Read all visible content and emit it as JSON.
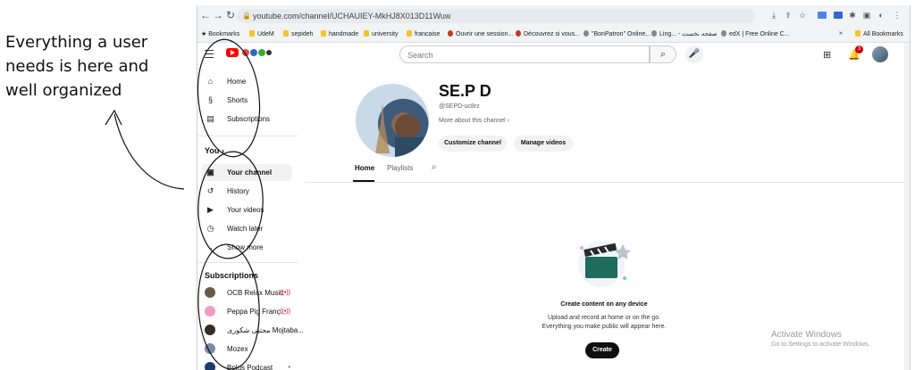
{
  "annotation": {
    "lines": [
      "Everything a user",
      "needs is here and",
      "well organized"
    ]
  },
  "browser": {
    "url": "youtube.com/channel/UCHAUIEY-MkHJ8X013D11Wuw",
    "bookmarks": [
      {
        "label": "Bookmarks",
        "icon": "star-icon"
      },
      {
        "label": "UdeM",
        "icon": "folder-icon"
      },
      {
        "label": "sepideh",
        "icon": "folder-icon"
      },
      {
        "label": "handmade",
        "icon": "folder-icon"
      },
      {
        "label": "university",
        "icon": "folder-icon"
      },
      {
        "label": "francaise",
        "icon": "folder-icon"
      },
      {
        "label": "Ouvrir une session...",
        "icon": "maple-leaf-icon"
      },
      {
        "label": "Découvrez si vous...",
        "icon": "maple-leaf-icon"
      },
      {
        "label": "\"BonPatron\" Online...",
        "icon": "target-icon"
      },
      {
        "label": "Ling... - صفحه نخست",
        "icon": "globe-icon"
      },
      {
        "label": "edX | Free Online C...",
        "icon": "edx-icon"
      }
    ],
    "all_bookmarks": "All Bookmarks"
  },
  "youtube": {
    "search_placeholder": "Search",
    "notification_count": "3",
    "sidebar": {
      "main": [
        {
          "label": "Home",
          "icon": "home-icon"
        },
        {
          "label": "Shorts",
          "icon": "shorts-icon"
        },
        {
          "label": "Subscriptions",
          "icon": "subscriptions-icon"
        }
      ],
      "you_label": "You",
      "you_items": [
        {
          "label": "Your channel",
          "icon": "channel-icon"
        },
        {
          "label": "History",
          "icon": "history-icon"
        },
        {
          "label": "Your videos",
          "icon": "video-icon"
        },
        {
          "label": "Watch later",
          "icon": "clock-icon"
        },
        {
          "label": "Show more",
          "icon": "chevron-down-icon"
        }
      ],
      "subscriptions_label": "Subscriptions",
      "subscriptions": [
        {
          "label": "OCB Relax Music",
          "badge": "live"
        },
        {
          "label": "Peppa Pig Franç...",
          "badge": "live"
        },
        {
          "label": "مجتبی شکوری Mojtaba...",
          "badge": ""
        },
        {
          "label": "Mozex",
          "badge": ""
        },
        {
          "label": "Bplus Podcast",
          "badge": "dot"
        }
      ]
    },
    "channel": {
      "name": "SE.P D",
      "handle": "@SEPD-uc8rz",
      "more": "More about this channel",
      "customize_label": "Customize channel",
      "manage_label": "Manage videos",
      "tabs": [
        "Home",
        "Playlists"
      ]
    },
    "empty_state": {
      "title": "Create content on any device",
      "line1": "Upload and record at home or on the go.",
      "line2": "Everything you make public will appear here.",
      "button": "Create"
    }
  },
  "os_watermark": {
    "title": "Activate Windows",
    "subtitle": "Go to Settings to activate Windows."
  }
}
